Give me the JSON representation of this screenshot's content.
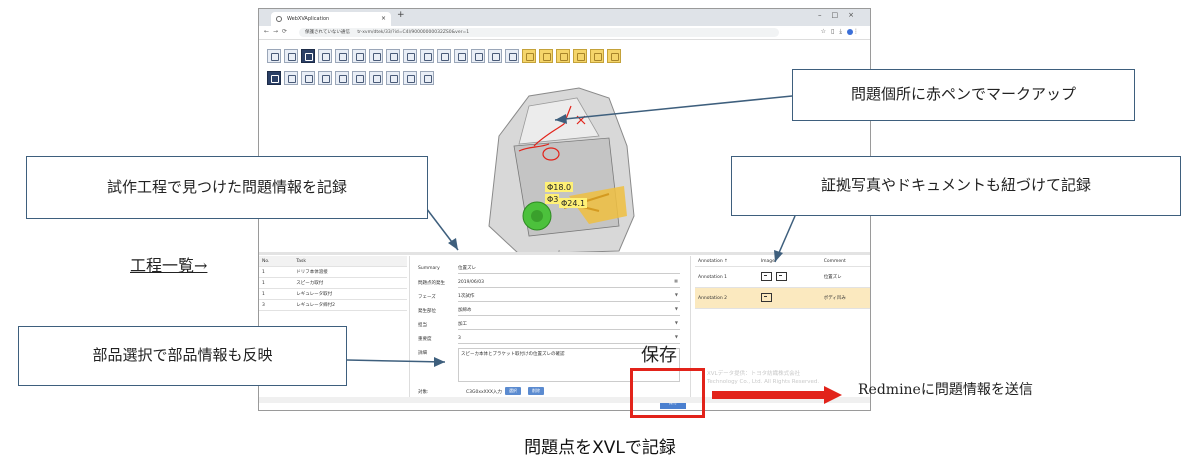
{
  "browser": {
    "tab_title": "WebXVAplication",
    "address_warning": "保護されていない通信",
    "url": "tr-xvm/dtek/33/?id=C4I/90000000032ZS0&ver=1"
  },
  "viewer": {
    "annotations": {
      "dim1": "Φ18.0",
      "dim2": "Φ3",
      "dim3": "Φ24.1"
    }
  },
  "task_table": {
    "headers": [
      "No.",
      "Task"
    ],
    "rows": [
      {
        "no": "1",
        "task": "ドリフ本体溶接"
      },
      {
        "no": "1",
        "task": "スピーカ取付"
      },
      {
        "no": "1",
        "task": "レギュレータ取付"
      },
      {
        "no": "3",
        "task": "レギュレータ締付2"
      }
    ]
  },
  "form": {
    "rows": [
      {
        "label": "Summary",
        "value": "位置ズレ"
      },
      {
        "label": "問題点的発生",
        "value": "2019/06/03"
      },
      {
        "label": "フェーズ",
        "value": "1次試作"
      },
      {
        "label": "発生部位",
        "value": "加締め"
      },
      {
        "label": "担当",
        "value": "加工"
      },
      {
        "label": "重要度",
        "value": "3"
      }
    ],
    "detail_label": "詳細",
    "detail_text": "スピーカ本体とブラケット取付けの位置ズレの確認",
    "target_label": "対象:",
    "target_value": "C3G0xxXXX入力",
    "btn_select": "選択",
    "btn_delete": "削除",
    "btn_save": "保存"
  },
  "annotation_table": {
    "headers": [
      "Annotation ↑",
      "Image",
      "Comment"
    ],
    "rows": [
      {
        "name": "Annotation 1",
        "comment": "位置ズレ"
      },
      {
        "name": "Annotation 2",
        "comment": "ボディ凹み"
      }
    ],
    "watermark_1": "XVLデータ提供：トヨタ紡織株式会社",
    "watermark_2": "Technology Co., Ltd. All Rights Reserved."
  },
  "callouts": {
    "markup": "問題個所に赤ペンでマークアップ",
    "record_info": "試作工程で見つけた問題情報を記録",
    "evidence": "証拠写真やドキュメントも紐づけて記録",
    "parts": "部品選択で部品情報も反映",
    "process_list": "工程一覧→",
    "save": "保存",
    "redmine": "Redmineに問題情報を送信"
  },
  "caption": "問題点をXVLで記録",
  "colors": {
    "accent_red": "#e2231a",
    "callout_border": "#3e5f7d",
    "button_blue": "#4a7fcf"
  }
}
